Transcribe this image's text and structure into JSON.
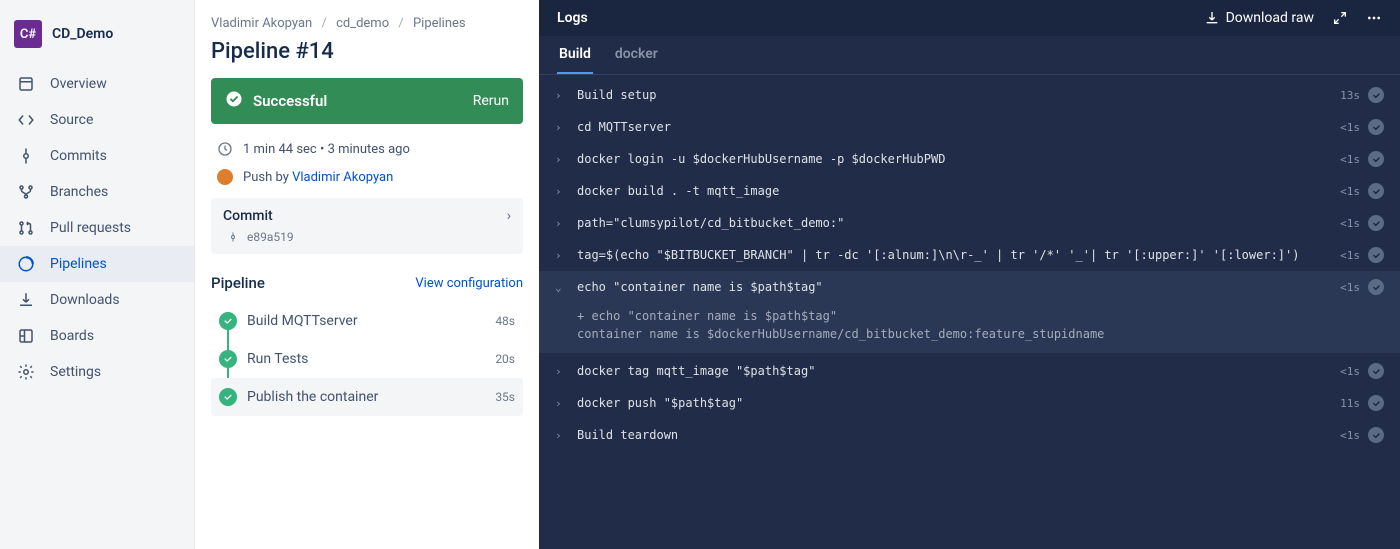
{
  "project": {
    "icon": "C#",
    "name": "CD_Demo"
  },
  "nav": [
    {
      "key": "overview",
      "label": "Overview"
    },
    {
      "key": "source",
      "label": "Source"
    },
    {
      "key": "commits",
      "label": "Commits"
    },
    {
      "key": "branches",
      "label": "Branches"
    },
    {
      "key": "pull-requests",
      "label": "Pull requests"
    },
    {
      "key": "pipelines",
      "label": "Pipelines",
      "active": true
    },
    {
      "key": "downloads",
      "label": "Downloads"
    },
    {
      "key": "boards",
      "label": "Boards"
    },
    {
      "key": "settings",
      "label": "Settings"
    }
  ],
  "breadcrumbs": {
    "owner": "Vladimir Akopyan",
    "repo": "cd_demo",
    "section": "Pipelines"
  },
  "page_title": "Pipeline #14",
  "status": {
    "label": "Successful",
    "rerun": "Rerun"
  },
  "meta": {
    "duration": "1 min 44 sec",
    "ago": "3 minutes ago",
    "push_by_prefix": "Push by ",
    "push_by_user": "Vladimir Akopyan"
  },
  "commit": {
    "label": "Commit",
    "hash": "e89a519"
  },
  "pipeline_section": {
    "title": "Pipeline",
    "view_config": "View configuration"
  },
  "steps": [
    {
      "name": "Build MQTTserver",
      "time": "48s"
    },
    {
      "name": "Run Tests",
      "time": "20s"
    },
    {
      "name": "Publish the container",
      "time": "35s",
      "selected": true
    }
  ],
  "logs": {
    "title": "Logs",
    "download": "Download raw",
    "tabs": [
      {
        "label": "Build",
        "active": true
      },
      {
        "label": "docker"
      }
    ],
    "rows": [
      {
        "cmd": "Build setup",
        "dur": "13s"
      },
      {
        "cmd": "cd MQTTserver",
        "dur": "<1s"
      },
      {
        "cmd": "docker login -u $dockerHubUsername -p $dockerHubPWD",
        "dur": "<1s"
      },
      {
        "cmd": "docker build . -t mqtt_image",
        "dur": "<1s"
      },
      {
        "cmd": "path=\"clumsypilot/cd_bitbucket_demo:\"",
        "dur": "<1s"
      },
      {
        "cmd": "tag=$(echo \"$BITBUCKET_BRANCH\" | tr -dc '[:alnum:]\\n\\r-_' | tr '/*' '_'| tr '[:upper:]' '[:lower:]')",
        "dur": "<1s"
      },
      {
        "cmd": "echo \"container name is $path$tag\"",
        "dur": "<1s",
        "expanded": true,
        "output": "+ echo \"container name is $path$tag\"\ncontainer name is $dockerHubUsername/cd_bitbucket_demo:feature_stupidname"
      },
      {
        "cmd": "docker tag mqtt_image \"$path$tag\"",
        "dur": "<1s"
      },
      {
        "cmd": "docker push \"$path$tag\"",
        "dur": "11s"
      },
      {
        "cmd": "Build teardown",
        "dur": "<1s"
      }
    ]
  }
}
